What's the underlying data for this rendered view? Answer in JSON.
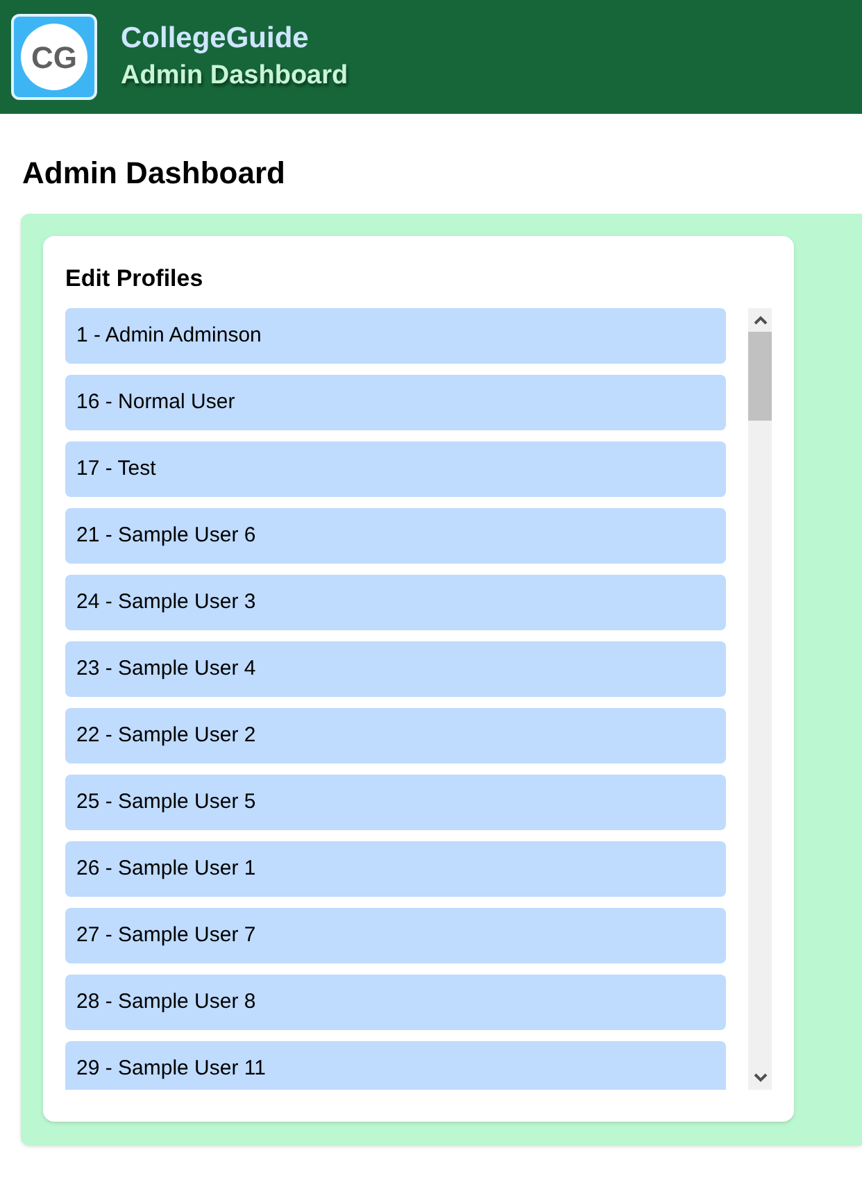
{
  "header": {
    "logo": "CG",
    "title": "CollegeGuide",
    "subtitle": "Admin Dashboard"
  },
  "page_title": "Admin Dashboard",
  "card": {
    "title": "Edit Profiles",
    "profiles": [
      "1 - Admin Adminson",
      "16 - Normal User",
      "17 - Test",
      "21 - Sample User 6",
      "24 - Sample User 3",
      "23 - Sample User 4",
      "22 - Sample User 2",
      "25 - Sample User 5",
      "26 - Sample User 1",
      "27 - Sample User 7",
      "28 - Sample User 8",
      "29 - Sample User 11"
    ]
  }
}
